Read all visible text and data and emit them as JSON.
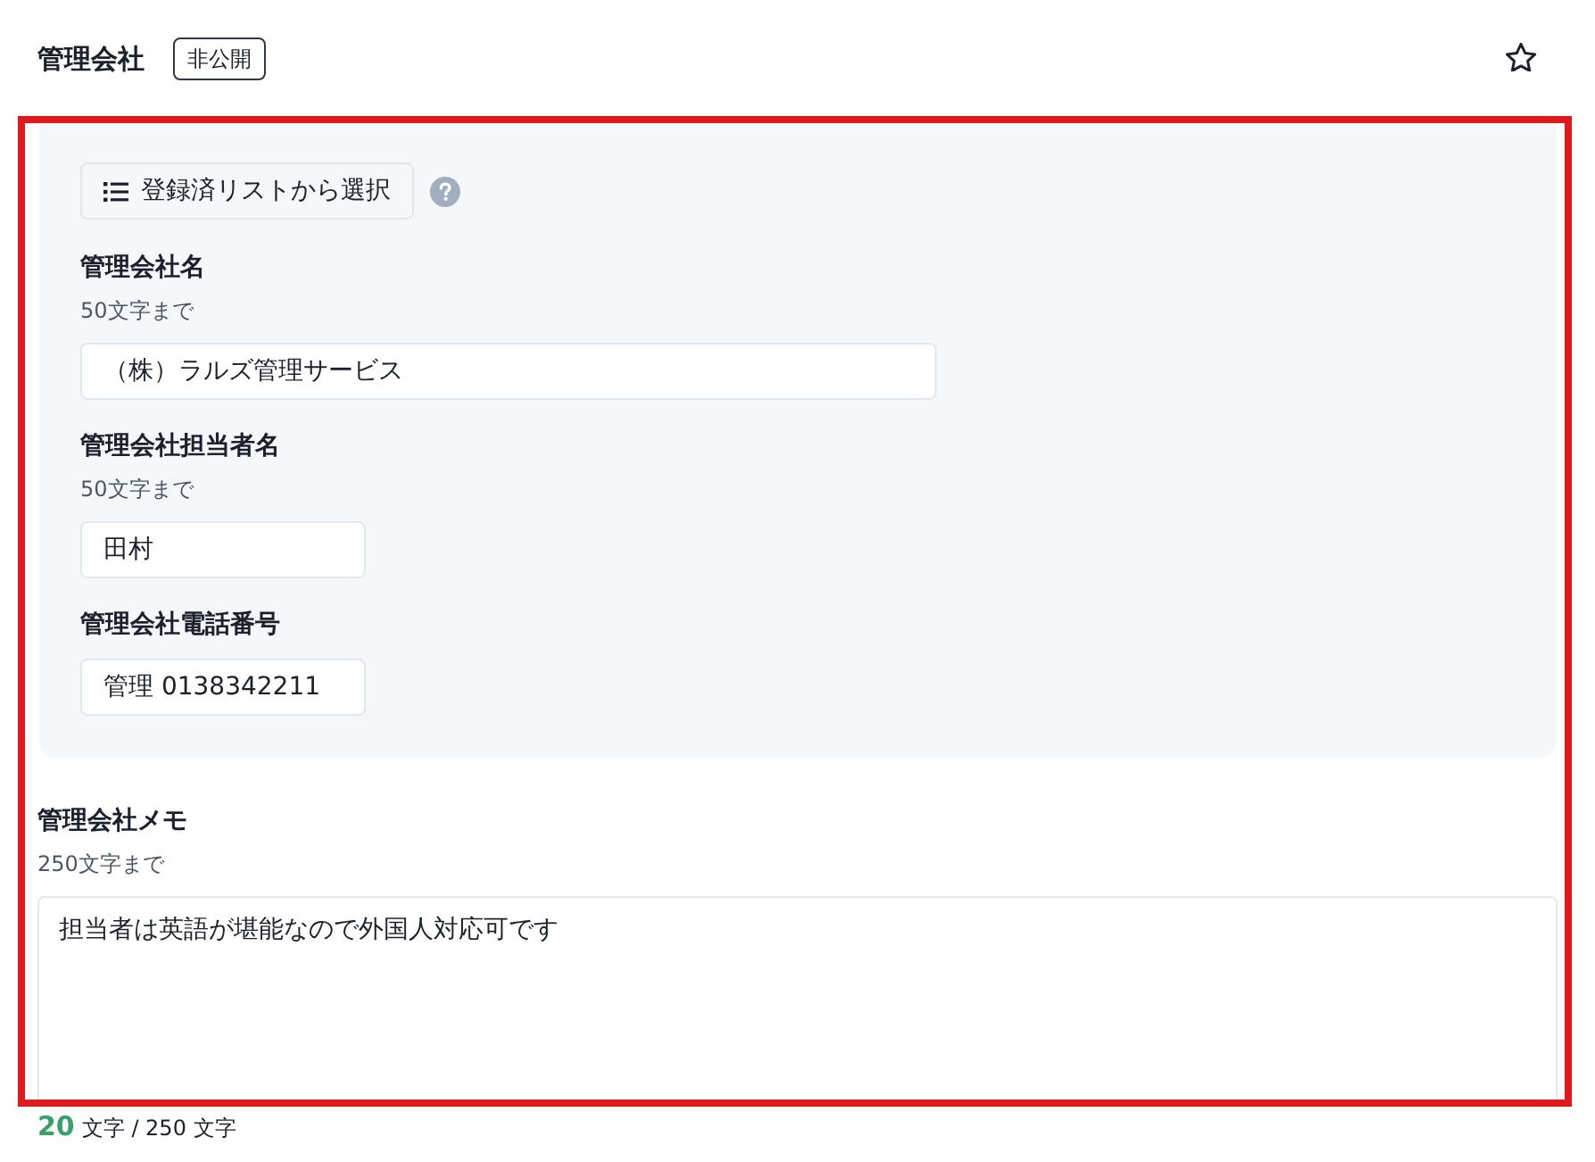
{
  "header": {
    "title": "管理会社",
    "badge": "非公開"
  },
  "panel": {
    "select_button": {
      "label": "登録済リストから選択"
    },
    "fields": [
      {
        "kind": "wide",
        "label": "管理会社名",
        "hint": "50文字まで",
        "value": "（株）ラルズ管理サービス"
      },
      {
        "kind": "narrow",
        "label": "管理会社担当者名",
        "hint": "50文字まで",
        "value": "田村"
      },
      {
        "kind": "narrow",
        "label": "管理会社電話番号",
        "value": "管理 0138342211"
      }
    ]
  },
  "memo": {
    "label": "管理会社メモ",
    "hint": "250文字まで",
    "value": "担当者は英語が堪能なので外国人対応可です"
  },
  "counter": {
    "count": "20",
    "text": "文字 / 250 文字"
  }
}
